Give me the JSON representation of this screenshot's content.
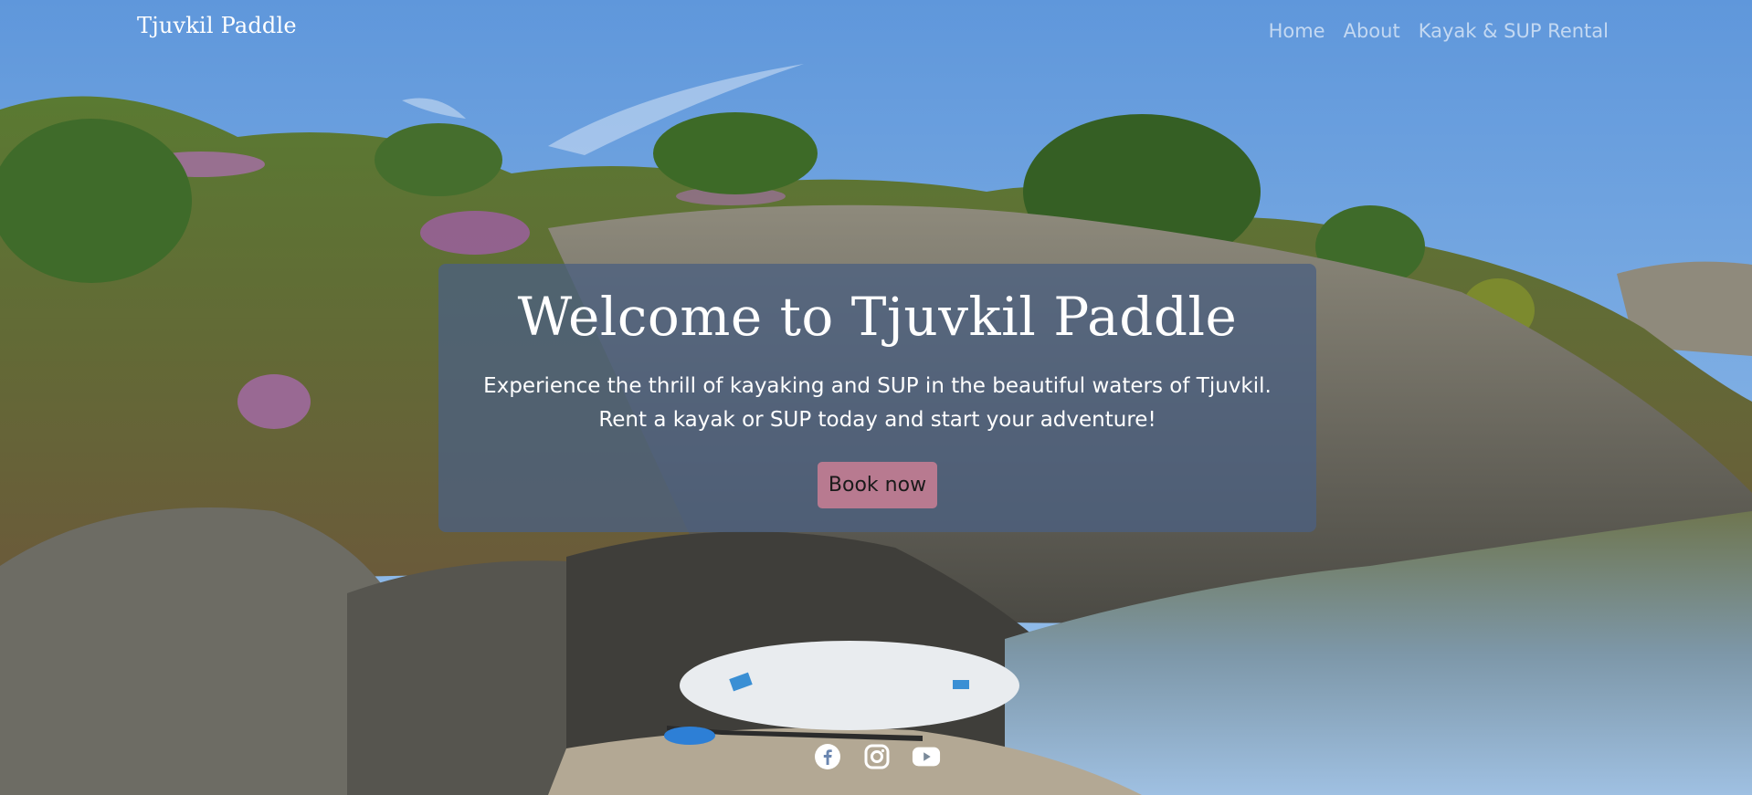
{
  "header": {
    "brand": "Tjuvkil Paddle",
    "nav": [
      {
        "label": "Home"
      },
      {
        "label": "About"
      },
      {
        "label": "Kayak & SUP Rental"
      }
    ]
  },
  "hero": {
    "title": "Welcome to Tjuvkil Paddle",
    "description": "Experience the thrill of kayaking and SUP in the beautiful waters of Tjuvkil. Rent a kayak or SUP today and start your adventure!",
    "button_label": "Book now"
  },
  "footer": {
    "social": [
      {
        "icon": "facebook-icon"
      },
      {
        "icon": "instagram-icon"
      },
      {
        "icon": "youtube-icon"
      }
    ]
  },
  "colors": {
    "hero_overlay": "#4c6080",
    "button_bg": "#b87a90",
    "nav_text": "#ffffff"
  }
}
